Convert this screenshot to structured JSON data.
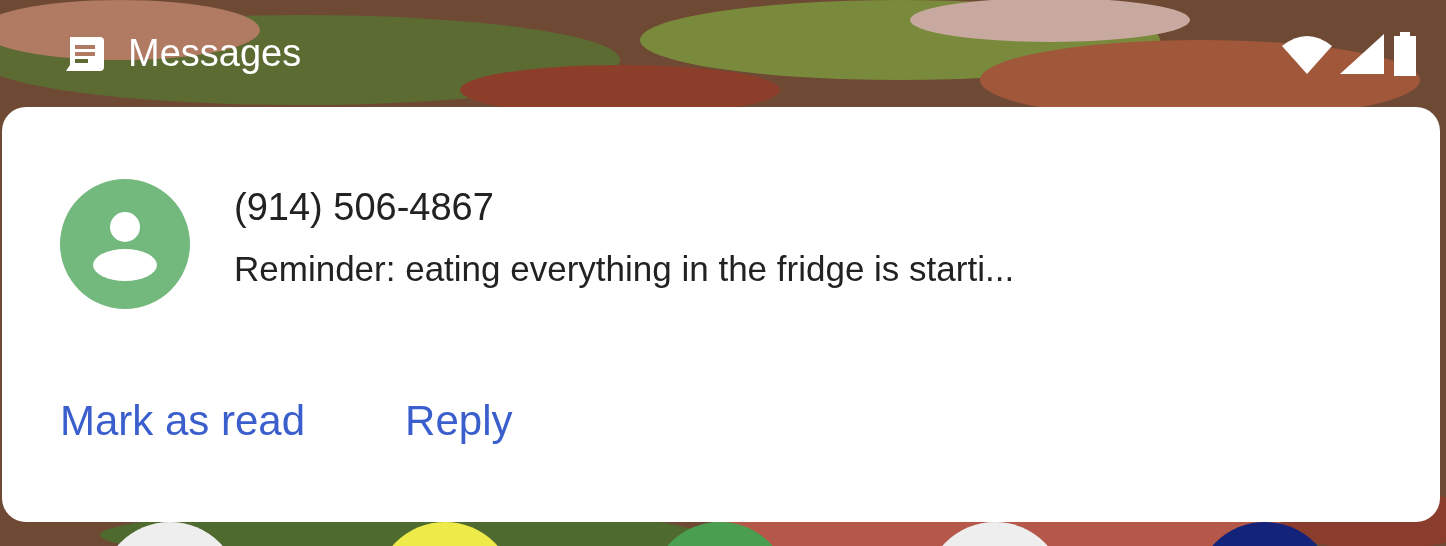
{
  "status_bar": {
    "app_name": "Messages"
  },
  "notification": {
    "title": "(914) 506-4867",
    "message": "Reminder: eating everything in the fridge is starti...",
    "actions": [
      "Mark as read",
      "Reply"
    ]
  }
}
